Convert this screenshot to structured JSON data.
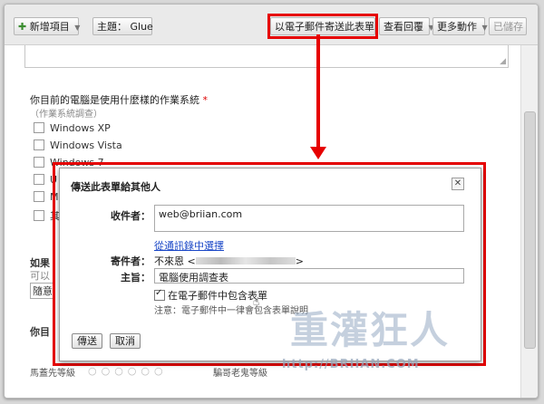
{
  "toolbar": {
    "add_item": "新增項目",
    "theme_label": "主題：",
    "theme_value": "Glue",
    "email_form": "以電子郵件寄送此表單",
    "view_responses": "查看回覆",
    "more_actions": "更多動作",
    "saved": "已儲存"
  },
  "form": {
    "question_title": "你目前的電腦是使用什麼樣的作業系統",
    "required_mark": "*",
    "question_help": "（作業系統調查）",
    "options": [
      "Windows XP",
      "Windows Vista",
      "Windows 7",
      "U",
      "M",
      "其"
    ],
    "side_texts": [
      "如果",
      "可以",
      "隨意",
      "你目"
    ],
    "scale_left": "馬蓋先等級",
    "scale_right": "騙哥老鬼等級"
  },
  "dialog": {
    "title": "傳送此表單給其他人",
    "close_icon": "close-icon",
    "to_label": "收件者：",
    "to_value": "web@briian.com",
    "contacts_link": "從通訊錄中選擇",
    "from_label": "寄件者：",
    "from_value_prefix": "不來恩 <",
    "from_value_suffix": ">",
    "subject_label": "主旨：",
    "subject_value": "電腦使用調查表",
    "include_label": "在電子郵件中包含表單",
    "include_checked": true,
    "note": "注意：電子郵件中一律會包含表單說明",
    "send_button": "傳送",
    "cancel_button": "取消"
  },
  "watermark": {
    "text": "重灌狂人",
    "url": "http://BRIIAN.COM"
  },
  "colors": {
    "highlight": "#e60000",
    "link": "#1a47c7"
  }
}
